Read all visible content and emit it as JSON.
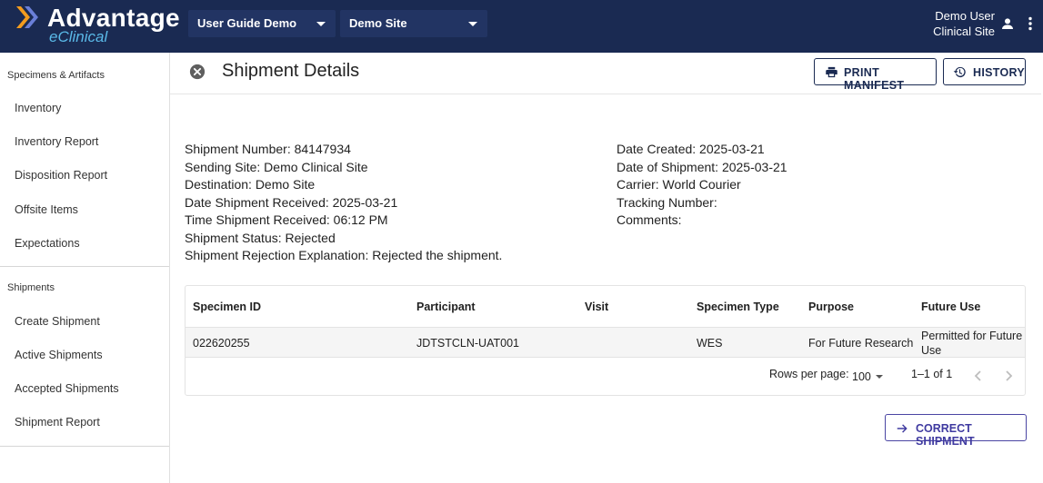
{
  "brand": {
    "name": "Advantage",
    "sub": "eClinical"
  },
  "header": {
    "study_dropdown": "User Guide Demo",
    "site_dropdown": "Demo Site",
    "user_name": "Demo User",
    "user_site": "Clinical Site",
    "icons": {
      "user": "account-icon",
      "menu": "more-vert-icon"
    }
  },
  "sidebar": {
    "sections": [
      {
        "title": "Specimens & Artifacts",
        "items": [
          "Inventory",
          "Inventory Report",
          "Disposition Report",
          "Offsite Items",
          "Expectations"
        ]
      },
      {
        "title": "Shipments",
        "items": [
          "Create Shipment",
          "Active Shipments",
          "Accepted Shipments",
          "Shipment Report"
        ]
      }
    ]
  },
  "page": {
    "title": "Shipment Details",
    "print_manifest": "PRINT MANIFEST",
    "history": "HISTORY",
    "correct_shipment": "CORRECT SHIPMENT"
  },
  "details_left": [
    "Shipment Number: 84147934",
    "Sending Site: Demo Clinical Site",
    "Destination: Demo Site",
    "Date Shipment Received: 2025-03-21",
    "Time Shipment Received: 06:12 PM",
    "Shipment Status: Rejected",
    "Shipment Rejection Explanation: Rejected the shipment."
  ],
  "details_right": [
    "Date Created: 2025-03-21",
    "Date of Shipment: 2025-03-21",
    "Carrier: World Courier",
    "Tracking Number:",
    "Comments:"
  ],
  "table": {
    "columns": [
      "Specimen ID",
      "Participant",
      "Visit",
      "Specimen Type",
      "Purpose",
      "Future Use"
    ],
    "rows": [
      [
        "022620255",
        "JDTSTCLN-UAT001",
        "",
        "WES",
        "For Future Research",
        "Permitted for Future Use"
      ]
    ],
    "rows_per_page_label": "Rows per page:",
    "rows_per_page_value": "100",
    "range": "1–1 of 1"
  },
  "colors": {
    "topbar": "#1a2a52",
    "accent": "#3f3aa0",
    "logo_sub": "#5ab9e8"
  }
}
